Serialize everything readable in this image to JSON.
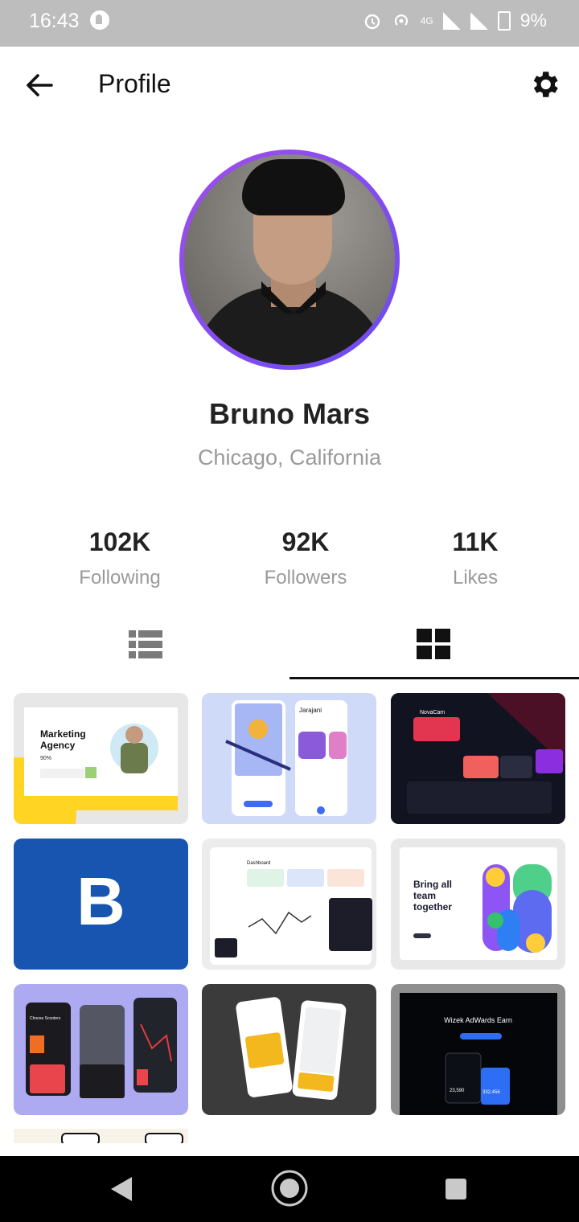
{
  "status_bar": {
    "time": "16:43",
    "network": "4G",
    "battery": "9%"
  },
  "header": {
    "title": "Profile"
  },
  "profile": {
    "name": "Bruno Mars",
    "location": "Chicago, California"
  },
  "stats": [
    {
      "value": "102K",
      "label": "Following"
    },
    {
      "value": "92K",
      "label": "Followers"
    },
    {
      "value": "11K",
      "label": "Likes"
    }
  ],
  "tabs": [
    {
      "icon": "list-icon",
      "selected": false
    },
    {
      "icon": "grid-icon",
      "selected": true
    }
  ],
  "gallery": [
    {
      "text": [
        "Marketing",
        "Agency",
        "90%"
      ]
    },
    {
      "text": [
        "Jarajani"
      ]
    },
    {
      "text": [
        "NovaCam"
      ]
    },
    {
      "text": [
        "B"
      ]
    },
    {
      "text": [
        "Dashboard"
      ]
    },
    {
      "text": [
        "Bring all",
        "team",
        "together"
      ]
    },
    {
      "text": [
        "Choose Scooters"
      ]
    },
    {
      "text": []
    },
    {
      "text": [
        "Wizek AdWards Earn",
        "23,590",
        "332,456"
      ]
    }
  ],
  "colors": {
    "accent_ring_start": "#a04dee",
    "accent_ring_end": "#6a4cf0",
    "status_bar": "#bdbdbd"
  }
}
